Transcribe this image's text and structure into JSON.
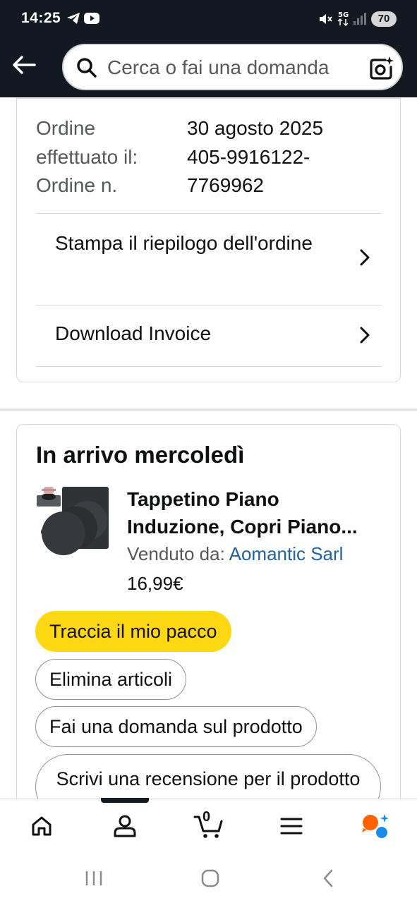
{
  "status_bar": {
    "time": "14:25",
    "battery": "70",
    "network": "5G"
  },
  "header": {
    "search": {
      "placeholder": "Cerca o fai una domanda"
    }
  },
  "order_info": {
    "date_label": "Ordine effettuato il:",
    "date_value": "30 agosto 2025",
    "number_label": "Ordine n.",
    "number_value": "405-9916122-7769962",
    "links": [
      {
        "label": "Stampa il riepilogo dell'ordine"
      },
      {
        "label": "Download Invoice"
      }
    ]
  },
  "shipment": {
    "title": "In arrivo mercoledì",
    "product": {
      "title_line1": "Tappetino Piano",
      "title_line2": "Induzione, Copri Piano...",
      "seller_label": "Venduto da:",
      "seller_name": "Aomantic Sarl",
      "price": "16,99€"
    },
    "actions": {
      "track": "Traccia il mio pacco",
      "remove": "Elimina articoli",
      "question": "Fai una domanda sul prodotto",
      "review": "Scrivi una recensione per il prodotto"
    }
  },
  "bottom_nav": {
    "cart_count": "0",
    "items": [
      "home-icon",
      "account-icon",
      "cart-icon",
      "menu-icon",
      "rufus-icon"
    ]
  },
  "colors": {
    "header_bg": "#131921",
    "primary_button": "#ffd814",
    "link": "#2162a1",
    "border": "#d5d9d9"
  }
}
